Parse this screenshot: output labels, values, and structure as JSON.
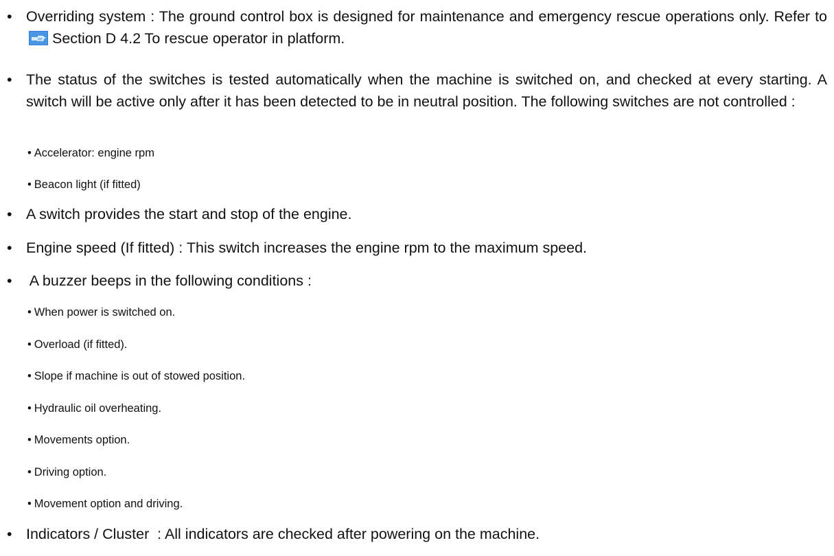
{
  "bullet_char": "•",
  "paragraphs": {
    "overriding": {
      "text_before_icon": "Overriding system : The ground control box is designed for maintenance and emergency rescue operations only. Refer to",
      "icon": "pointing-hand-reference-icon",
      "text_after_icon": "Section D 4.2 To rescue operator in platform."
    },
    "switch_status": {
      "text": "The status of the switches is tested automatically when the machine is switched on, and checked at every starting.  A switch will be active only after it has been detected to be in neutral position.  The following switches are not controlled :",
      "items": [
        "Accelerator: engine rpm",
        "Beacon light (if fitted)"
      ]
    },
    "start_stop": {
      "text": "A switch provides the start and stop of the engine."
    },
    "engine_speed": {
      "text": "Engine speed (If fitted) : This switch increases the engine rpm to the maximum speed."
    },
    "buzzer": {
      "text": " A buzzer beeps in the following conditions :",
      "items": [
        "When power is switched on.",
        "Overload (if fitted).",
        "Slope if machine is out of stowed position.",
        "Hydraulic oil overheating.",
        "Movements option.",
        "Driving option.",
        "Movement option and driving."
      ]
    },
    "indicators": {
      "text": "Indicators / Cluster  : All indicators are checked after powering on the machine."
    }
  },
  "colors": {
    "text": "#111111",
    "icon_blue": "#2f7fd6",
    "icon_light": "#d8ecfb"
  }
}
